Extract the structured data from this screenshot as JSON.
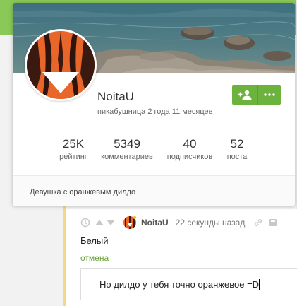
{
  "profile": {
    "username": "NoitaU",
    "tenure": "пикабушница 2 года 11 месяцев",
    "bio": "Девушка с оранжевым дилдо",
    "stats": [
      {
        "value": "25K",
        "label": "рейтинг"
      },
      {
        "value": "5349",
        "label": "комментариев"
      },
      {
        "value": "40",
        "label": "подписчиков"
      },
      {
        "value": "52",
        "label": "поста"
      }
    ],
    "colors": {
      "accent": "#6cb33e",
      "avatar": "#e8662a"
    },
    "icons": {
      "subscribe": "add-user-icon",
      "more": "more-dots-icon"
    }
  },
  "comment": {
    "author": "NoitaU",
    "time": "22 секунды назад",
    "text": "Белый",
    "cancel_label": "отмена",
    "reply_value": "Но дилдо у тебя точно оранжевое =D",
    "icons": [
      "clock-icon",
      "arrow-up-icon",
      "arrow-down-icon",
      "link-icon",
      "save-icon"
    ]
  }
}
